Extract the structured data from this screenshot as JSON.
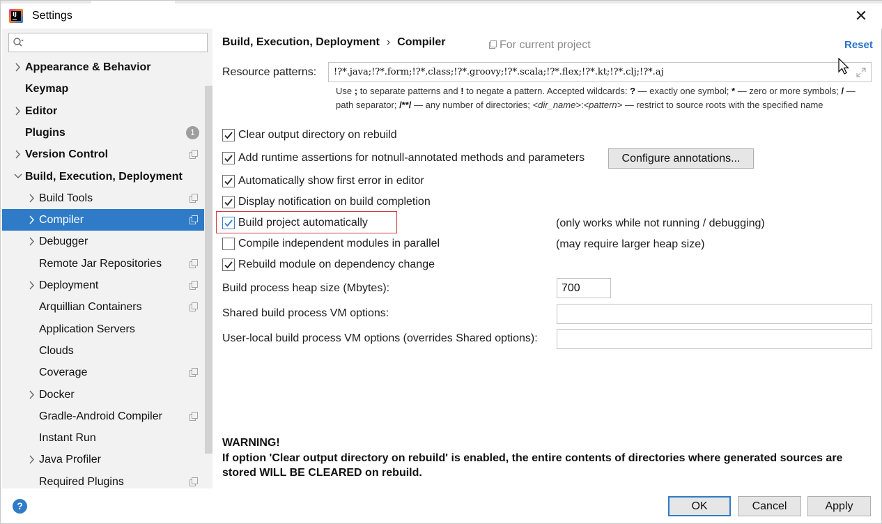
{
  "window": {
    "title": "Settings",
    "close_glyph": "✕"
  },
  "search": {
    "placeholder": "",
    "value": ""
  },
  "sidebar": {
    "items": [
      {
        "label": "Appearance & Behavior",
        "bold": true,
        "chevron": "right",
        "level": 0
      },
      {
        "label": "Keymap",
        "bold": true,
        "chevron": "none",
        "level": 0
      },
      {
        "label": "Editor",
        "bold": true,
        "chevron": "right",
        "level": 0
      },
      {
        "label": "Plugins",
        "bold": true,
        "chevron": "none",
        "level": 0,
        "badge": "1"
      },
      {
        "label": "Version Control",
        "bold": true,
        "chevron": "right",
        "level": 0,
        "project_icon": true
      },
      {
        "label": "Build, Execution, Deployment",
        "bold": true,
        "chevron": "down",
        "level": 0
      },
      {
        "label": "Build Tools",
        "bold": false,
        "chevron": "right",
        "level": 1,
        "project_icon": true
      },
      {
        "label": "Compiler",
        "bold": false,
        "chevron": "right",
        "level": 1,
        "project_icon": true,
        "selected": true
      },
      {
        "label": "Debugger",
        "bold": false,
        "chevron": "right",
        "level": 1
      },
      {
        "label": "Remote Jar Repositories",
        "bold": false,
        "chevron": "none",
        "level": 1,
        "project_icon": true
      },
      {
        "label": "Deployment",
        "bold": false,
        "chevron": "right",
        "level": 1,
        "project_icon": true
      },
      {
        "label": "Arquillian Containers",
        "bold": false,
        "chevron": "none",
        "level": 1,
        "project_icon": true
      },
      {
        "label": "Application Servers",
        "bold": false,
        "chevron": "none",
        "level": 1
      },
      {
        "label": "Clouds",
        "bold": false,
        "chevron": "none",
        "level": 1
      },
      {
        "label": "Coverage",
        "bold": false,
        "chevron": "none",
        "level": 1,
        "project_icon": true
      },
      {
        "label": "Docker",
        "bold": false,
        "chevron": "right",
        "level": 1
      },
      {
        "label": "Gradle-Android Compiler",
        "bold": false,
        "chevron": "none",
        "level": 1,
        "project_icon": true
      },
      {
        "label": "Instant Run",
        "bold": false,
        "chevron": "none",
        "level": 1
      },
      {
        "label": "Java Profiler",
        "bold": false,
        "chevron": "right",
        "level": 1
      },
      {
        "label": "Required Plugins",
        "bold": false,
        "chevron": "none",
        "level": 1,
        "project_icon": true
      }
    ]
  },
  "header": {
    "breadcrumb_parent": "Build, Execution, Deployment",
    "breadcrumb_sep": "›",
    "breadcrumb_current": "Compiler",
    "scope_label": "For current project",
    "reset_label": "Reset"
  },
  "resource_patterns": {
    "label": "Resource patterns:",
    "value": "!?*.java;!?*.form;!?*.class;!?*.groovy;!?*.scala;!?*.flex;!?*.kt;!?*.clj;!?*.aj",
    "hint_parts": {
      "p1": "Use ",
      "b1": ";",
      "p2": " to separate patterns and ",
      "b2": "!",
      "p3": " to negate a pattern. Accepted wildcards: ",
      "b3": "?",
      "p4": " — exactly one symbol; ",
      "b4": "*",
      "p5": " — zero or more symbols; ",
      "b5": "/",
      "p6": " — path separator; ",
      "b6": "/**/",
      "p7": " — any number of directories; ",
      "i1": "<dir_name>",
      "p8": ":",
      "i2": "<pattern>",
      "p9": " — restrict to source roots with the specified name"
    }
  },
  "options": {
    "clear_output": {
      "label": "Clear output directory on rebuild",
      "checked": true
    },
    "runtime_assertions": {
      "label": "Add runtime assertions for notnull-annotated methods and parameters",
      "checked": true
    },
    "configure_annotations": "Configure annotations...",
    "show_first_error": {
      "label": "Automatically show first error in editor",
      "checked": true
    },
    "display_notification": {
      "label": "Display notification on build completion",
      "checked": true
    },
    "build_automatically": {
      "label": "Build project automatically",
      "checked": true,
      "note": "(only works while not running / debugging)"
    },
    "compile_parallel": {
      "label": "Compile independent modules in parallel",
      "checked": false,
      "note": "(may require larger heap size)"
    },
    "rebuild_on_dependency": {
      "label": "Rebuild module on dependency change",
      "checked": true
    }
  },
  "heap": {
    "label": "Build process heap size (Mbytes):",
    "value": "700"
  },
  "shared_vm": {
    "label": "Shared build process VM options:",
    "value": ""
  },
  "user_vm": {
    "label": "User-local build process VM options (overrides Shared options):",
    "value": ""
  },
  "warning": {
    "title": "WARNING!",
    "text": "If option 'Clear output directory on rebuild' is enabled, the entire contents of directories where generated sources are stored WILL BE CLEARED on rebuild."
  },
  "footer": {
    "help_glyph": "?",
    "ok_label": "OK",
    "cancel_label": "Cancel",
    "apply_label": "Apply"
  },
  "colors": {
    "accent": "#2f7bc8",
    "link": "#2a74c9",
    "highlight_border": "#d33b3b",
    "sidebar_bg": "#f2f2f2"
  }
}
